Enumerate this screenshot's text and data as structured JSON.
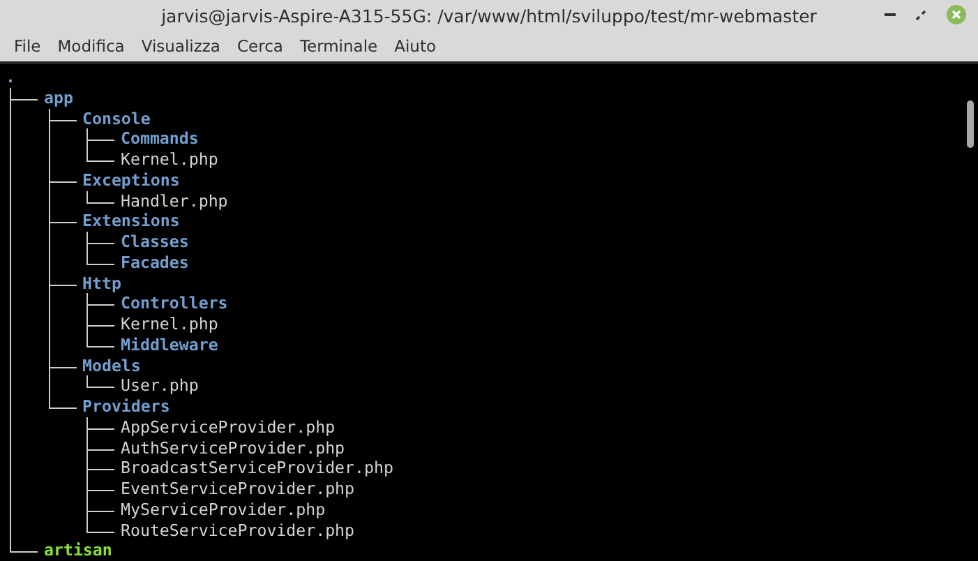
{
  "window": {
    "title": "jarvis@jarvis-Aspire-A315-55G: /var/www/html/sviluppo/test/mr-webmaster"
  },
  "menu": [
    "File",
    "Modifica",
    "Visualizza",
    "Cerca",
    "Terminale",
    "Aiuto"
  ],
  "tree": {
    "name": ".",
    "kind": "dir",
    "children": [
      {
        "name": "app",
        "kind": "dir",
        "children": [
          {
            "name": "Console",
            "kind": "dir",
            "children": [
              {
                "name": "Commands",
                "kind": "dir"
              },
              {
                "name": "Kernel.php",
                "kind": "file"
              }
            ]
          },
          {
            "name": "Exceptions",
            "kind": "dir",
            "children": [
              {
                "name": "Handler.php",
                "kind": "file"
              }
            ]
          },
          {
            "name": "Extensions",
            "kind": "dir",
            "children": [
              {
                "name": "Classes",
                "kind": "dir"
              },
              {
                "name": "Facades",
                "kind": "dir"
              }
            ]
          },
          {
            "name": "Http",
            "kind": "dir",
            "children": [
              {
                "name": "Controllers",
                "kind": "dir"
              },
              {
                "name": "Kernel.php",
                "kind": "file"
              },
              {
                "name": "Middleware",
                "kind": "dir"
              }
            ]
          },
          {
            "name": "Models",
            "kind": "dir",
            "children": [
              {
                "name": "User.php",
                "kind": "file"
              }
            ]
          },
          {
            "name": "Providers",
            "kind": "dir",
            "children": [
              {
                "name": "AppServiceProvider.php",
                "kind": "file"
              },
              {
                "name": "AuthServiceProvider.php",
                "kind": "file"
              },
              {
                "name": "BroadcastServiceProvider.php",
                "kind": "file"
              },
              {
                "name": "EventServiceProvider.php",
                "kind": "file"
              },
              {
                "name": "MyServiceProvider.php",
                "kind": "file"
              },
              {
                "name": "RouteServiceProvider.php",
                "kind": "file"
              }
            ]
          }
        ]
      },
      {
        "name": "artisan",
        "kind": "exec"
      }
    ]
  }
}
